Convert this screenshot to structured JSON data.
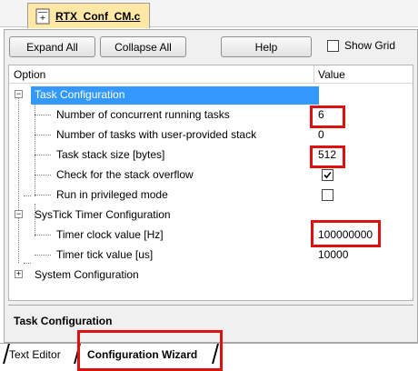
{
  "file_tab": {
    "label": "RTX_Conf_CM.c",
    "icon": "c-file-icon"
  },
  "toolbar": {
    "expand_all": "Expand All",
    "collapse_all": "Collapse All",
    "help": "Help",
    "show_grid": "Show Grid",
    "show_grid_checked": false
  },
  "tree": {
    "header": {
      "option": "Option",
      "value": "Value"
    },
    "nodes": [
      {
        "label": "Task Configuration",
        "expanded": true,
        "selected": true
      },
      {
        "label": "Number of concurrent running tasks",
        "value": "6"
      },
      {
        "label": "Number of tasks with user-provided stack",
        "value": "0"
      },
      {
        "label": "Task stack size [bytes]",
        "value": "512"
      },
      {
        "label": "Check for the stack overflow",
        "checked": true
      },
      {
        "label": "Run in privileged mode",
        "checked": false
      },
      {
        "label": "SysTick Timer Configuration",
        "expanded": true
      },
      {
        "label": "Timer clock value [Hz]",
        "value": "100000000"
      },
      {
        "label": "Timer tick value [us]",
        "value": "10000"
      },
      {
        "label": "System Configuration",
        "expanded": false
      }
    ]
  },
  "description": {
    "title": "Task Configuration"
  },
  "bottom_tabs": [
    {
      "label": "Text Editor",
      "active": false
    },
    {
      "label": "Configuration Wizard",
      "active": true
    }
  ],
  "colors": {
    "selection": "#3399ff",
    "highlight_box": "#e01010",
    "file_tab": "#ffe8a6"
  }
}
